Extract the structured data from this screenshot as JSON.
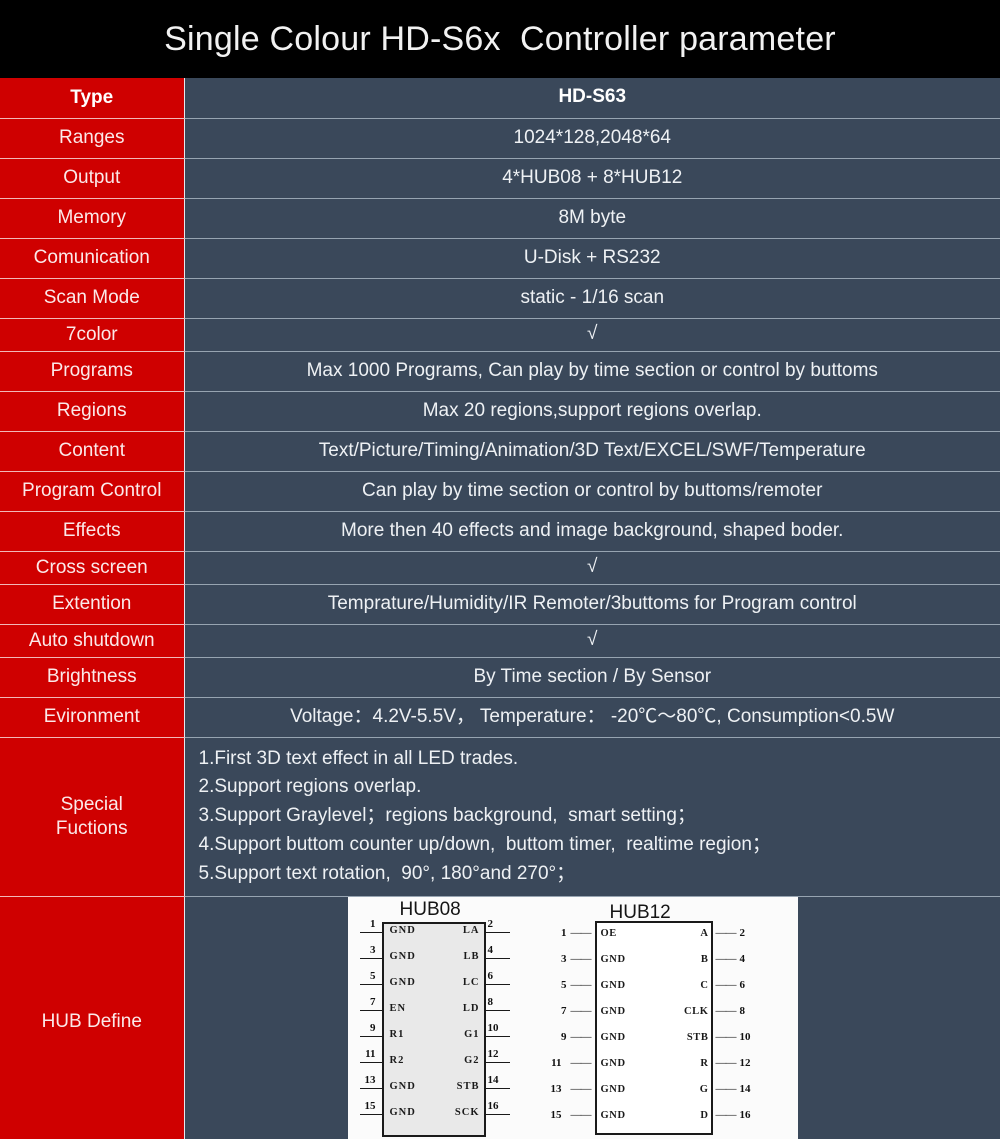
{
  "title": "Single Colour HD-S6x  Controller parameter",
  "table": {
    "header": {
      "label": "Type",
      "value": "HD-S63"
    },
    "rows": [
      {
        "label": "Ranges",
        "value": "1024*128,2048*64"
      },
      {
        "label": "Output",
        "value": "4*HUB08 + 8*HUB12"
      },
      {
        "label": "Memory",
        "value": "8M byte"
      },
      {
        "label": "Comunication",
        "value": "U-Disk + RS232"
      },
      {
        "label": "Scan Mode",
        "value": "static - 1/16 scan"
      },
      {
        "label": "7color",
        "value": "√"
      },
      {
        "label": "Programs",
        "value": "Max 1000 Programs,  Can play by time section or control by buttoms"
      },
      {
        "label": "Regions",
        "value": "Max 20 regions,support regions overlap."
      },
      {
        "label": "Content",
        "value": "Text/Picture/Timing/Animation/3D Text/EXCEL/SWF/Temperature"
      },
      {
        "label": "Program Control",
        "value": "Can play by time section or control by buttoms/remoter"
      },
      {
        "label": "Effects",
        "value": "More then 40 effects and image background, shaped boder."
      },
      {
        "label": "Cross screen",
        "value": "√"
      },
      {
        "label": "Extention",
        "value": "Temprature/Humidity/IR Remoter/3buttoms for Program control"
      },
      {
        "label": "Auto shutdown",
        "value": "√"
      },
      {
        "label": "Brightness",
        "value": "By Time section / By Sensor"
      },
      {
        "label": "Evironment",
        "value": "Voltage：4.2V-5.5V，   Temperature：  -20℃～80℃,   Consumption<0.5W"
      }
    ],
    "special": {
      "label_line1": "Special",
      "label_line2": "Fuctions",
      "items": [
        "1.First 3D text effect in all LED trades.",
        "2.Support regions overlap.",
        "3.Support Graylevel；regions background,  smart setting；",
        "4.Support buttom counter up/down,  buttom timer,  realtime region；",
        "5.Support text rotation,  90°, 180°and 270°；"
      ]
    },
    "hub": {
      "label": "HUB Define",
      "hub08": {
        "title": "HUB08",
        "pins": [
          {
            "lnum": "1",
            "lname": "GND",
            "rname": "LA",
            "rnum": "2"
          },
          {
            "lnum": "3",
            "lname": "GND",
            "rname": "LB",
            "rnum": "4"
          },
          {
            "lnum": "5",
            "lname": "GND",
            "rname": "LC",
            "rnum": "6"
          },
          {
            "lnum": "7",
            "lname": "EN",
            "rname": "LD",
            "rnum": "8"
          },
          {
            "lnum": "9",
            "lname": "R1",
            "rname": "G1",
            "rnum": "10"
          },
          {
            "lnum": "11",
            "lname": "R2",
            "rname": "G2",
            "rnum": "12"
          },
          {
            "lnum": "13",
            "lname": "GND",
            "rname": "STB",
            "rnum": "14"
          },
          {
            "lnum": "15",
            "lname": "GND",
            "rname": "SCK",
            "rnum": "16"
          }
        ]
      },
      "hub12": {
        "title": "HUB12",
        "dash": "——",
        "pins": [
          {
            "lnum": "1",
            "lname": "OE",
            "rname": "A",
            "rnum": "2"
          },
          {
            "lnum": "3",
            "lname": "GND",
            "rname": "B",
            "rnum": "4"
          },
          {
            "lnum": "5",
            "lname": "GND",
            "rname": "C",
            "rnum": "6"
          },
          {
            "lnum": "7",
            "lname": "GND",
            "rname": "CLK",
            "rnum": "8"
          },
          {
            "lnum": "9",
            "lname": "GND",
            "rname": "STB",
            "rnum": "10"
          },
          {
            "lnum": "11",
            "lname": "GND",
            "rname": "R",
            "rnum": "12"
          },
          {
            "lnum": "13",
            "lname": "GND",
            "rname": "G",
            "rnum": "14"
          },
          {
            "lnum": "15",
            "lname": "GND",
            "rname": "D",
            "rnum": "16"
          }
        ]
      }
    }
  },
  "colors": {
    "label_red": "#cf0000",
    "value_blue": "#3a485a",
    "title_bg": "#000000",
    "text_light": "#eef1f4"
  }
}
